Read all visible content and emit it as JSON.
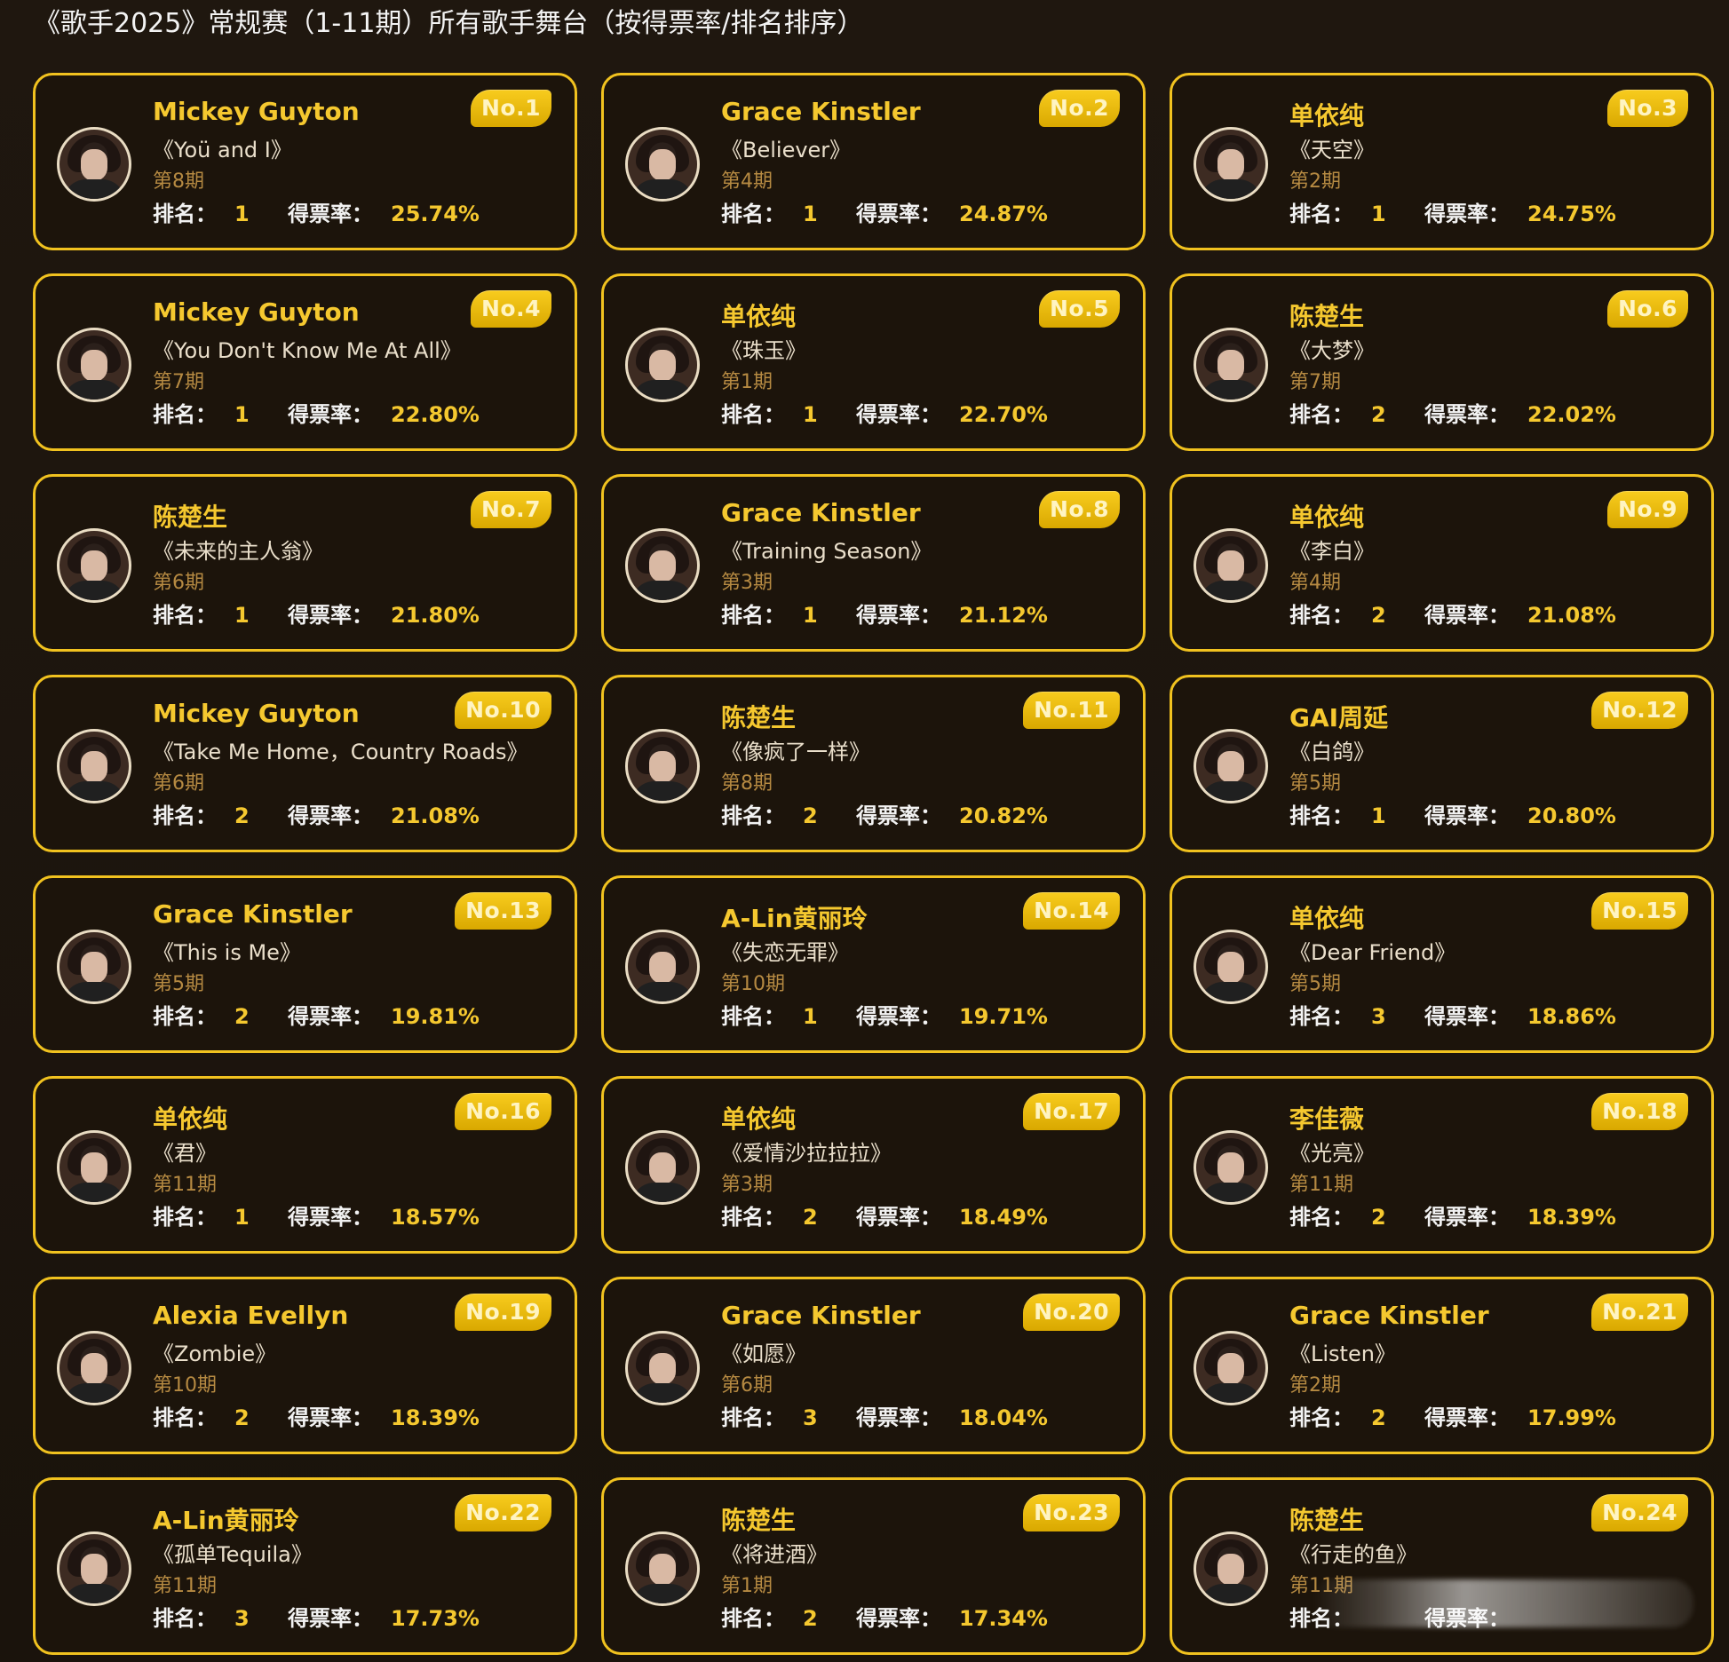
{
  "page": {
    "title": "《歌手2025》常规赛（1-11期）所有歌手舞台（按得票率/排名排序）"
  },
  "labels": {
    "rank_label": "排名：",
    "rate_label": "得票率："
  },
  "cards": [
    {
      "no": "No.1",
      "singer": "Mickey Guyton",
      "song": "《Yoü and I》",
      "episode": "第8期",
      "rank": "1",
      "rate": "25.74%"
    },
    {
      "no": "No.2",
      "singer": "Grace Kinstler",
      "song": "《Believer》",
      "episode": "第4期",
      "rank": "1",
      "rate": "24.87%"
    },
    {
      "no": "No.3",
      "singer": "单依纯",
      "song": "《天空》",
      "episode": "第2期",
      "rank": "1",
      "rate": "24.75%"
    },
    {
      "no": "No.4",
      "singer": "Mickey Guyton",
      "song": "《You Don't Know Me At All》",
      "episode": "第7期",
      "rank": "1",
      "rate": "22.80%"
    },
    {
      "no": "No.5",
      "singer": "单依纯",
      "song": "《珠玉》",
      "episode": "第1期",
      "rank": "1",
      "rate": "22.70%"
    },
    {
      "no": "No.6",
      "singer": "陈楚生",
      "song": "《大梦》",
      "episode": "第7期",
      "rank": "2",
      "rate": "22.02%"
    },
    {
      "no": "No.7",
      "singer": "陈楚生",
      "song": "《未来的主人翁》",
      "episode": "第6期",
      "rank": "1",
      "rate": "21.80%"
    },
    {
      "no": "No.8",
      "singer": "Grace Kinstler",
      "song": "《Training Season》",
      "episode": "第3期",
      "rank": "1",
      "rate": "21.12%"
    },
    {
      "no": "No.9",
      "singer": "单依纯",
      "song": "《李白》",
      "episode": "第4期",
      "rank": "2",
      "rate": "21.08%"
    },
    {
      "no": "No.10",
      "singer": "Mickey Guyton",
      "song": "《Take Me Home，Country Roads》",
      "episode": "第6期",
      "rank": "2",
      "rate": "21.08%"
    },
    {
      "no": "No.11",
      "singer": "陈楚生",
      "song": "《像疯了一样》",
      "episode": "第8期",
      "rank": "2",
      "rate": "20.82%"
    },
    {
      "no": "No.12",
      "singer": "GAI周延",
      "song": "《白鸽》",
      "episode": "第5期",
      "rank": "1",
      "rate": "20.80%"
    },
    {
      "no": "No.13",
      "singer": "Grace Kinstler",
      "song": "《This is Me》",
      "episode": "第5期",
      "rank": "2",
      "rate": "19.81%"
    },
    {
      "no": "No.14",
      "singer": "A-Lin黄丽玲",
      "song": "《失恋无罪》",
      "episode": "第10期",
      "rank": "1",
      "rate": "19.71%"
    },
    {
      "no": "No.15",
      "singer": "单依纯",
      "song": "《Dear Friend》",
      "episode": "第5期",
      "rank": "3",
      "rate": "18.86%"
    },
    {
      "no": "No.16",
      "singer": "单依纯",
      "song": "《君》",
      "episode": "第11期",
      "rank": "1",
      "rate": "18.57%"
    },
    {
      "no": "No.17",
      "singer": "单依纯",
      "song": "《爱情沙拉拉拉》",
      "episode": "第3期",
      "rank": "2",
      "rate": "18.49%"
    },
    {
      "no": "No.18",
      "singer": "李佳薇",
      "song": "《光亮》",
      "episode": "第11期",
      "rank": "2",
      "rate": "18.39%"
    },
    {
      "no": "No.19",
      "singer": "Alexia Evellyn",
      "song": "《Zombie》",
      "episode": "第10期",
      "rank": "2",
      "rate": "18.39%"
    },
    {
      "no": "No.20",
      "singer": "Grace Kinstler",
      "song": "《如愿》",
      "episode": "第6期",
      "rank": "3",
      "rate": "18.04%"
    },
    {
      "no": "No.21",
      "singer": "Grace Kinstler",
      "song": "《Listen》",
      "episode": "第2期",
      "rank": "2",
      "rate": "17.99%"
    },
    {
      "no": "No.22",
      "singer": "A-Lin黄丽玲",
      "song": "《孤单Tequila》",
      "episode": "第11期",
      "rank": "3",
      "rate": "17.73%"
    },
    {
      "no": "No.23",
      "singer": "陈楚生",
      "song": "《将进酒》",
      "episode": "第1期",
      "rank": "2",
      "rate": "17.34%"
    },
    {
      "no": "No.24",
      "singer": "陈楚生",
      "song": "《行走的鱼》",
      "episode": "第11期",
      "rank": "",
      "rate": ""
    }
  ],
  "colors": {
    "accent_gold": "#f1c21f",
    "background": "#1b140d",
    "episode_text": "#b68a42"
  }
}
